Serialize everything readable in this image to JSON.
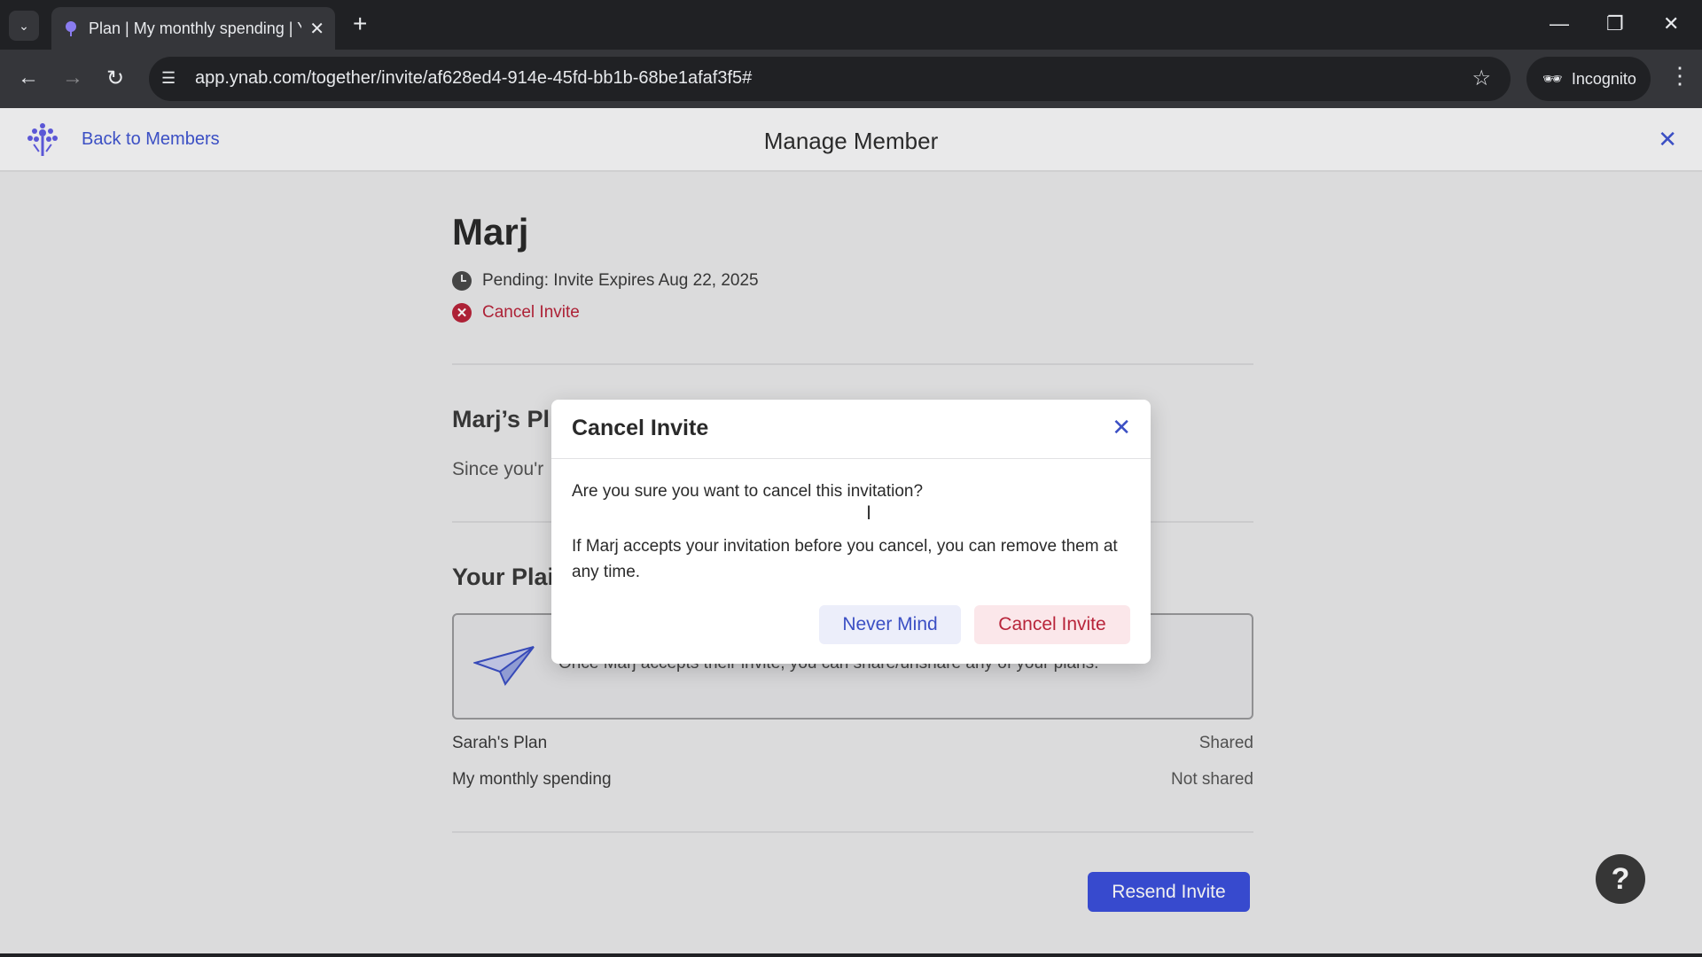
{
  "browser": {
    "tab_title": "Plan | My monthly spending | YNAB",
    "url": "app.ynab.com/together/invite/af628ed4-914e-45fd-bb1b-68be1afaf3f5#",
    "incognito_label": "Incognito"
  },
  "header": {
    "back_label": "Back to Members",
    "title": "Manage Member"
  },
  "member": {
    "name": "Marj",
    "status": "Pending: Invite Expires Aug 22, 2025",
    "cancel_label": "Cancel Invite"
  },
  "sections": {
    "marj_plans_heading": "Marj’s Pl",
    "marj_plans_text": "Since you'r",
    "your_plans_heading": "Your Plai",
    "info_text": "Once Marj accepts their invite, you can share/unshare any of your plans."
  },
  "plans": [
    {
      "name": "Sarah's Plan",
      "status": "Shared"
    },
    {
      "name": "My monthly spending",
      "status": "Not shared"
    }
  ],
  "resend_label": "Resend Invite",
  "help_label": "?",
  "modal": {
    "title": "Cancel Invite",
    "question": "Are you sure you want to cancel this invitation?",
    "body": "If Marj accepts your invitation before you cancel, you can remove them at any time.",
    "never_mind_label": "Never Mind",
    "cancel_label": "Cancel Invite"
  },
  "colors": {
    "accent": "#3b4fdb",
    "danger": "#b8243a"
  }
}
